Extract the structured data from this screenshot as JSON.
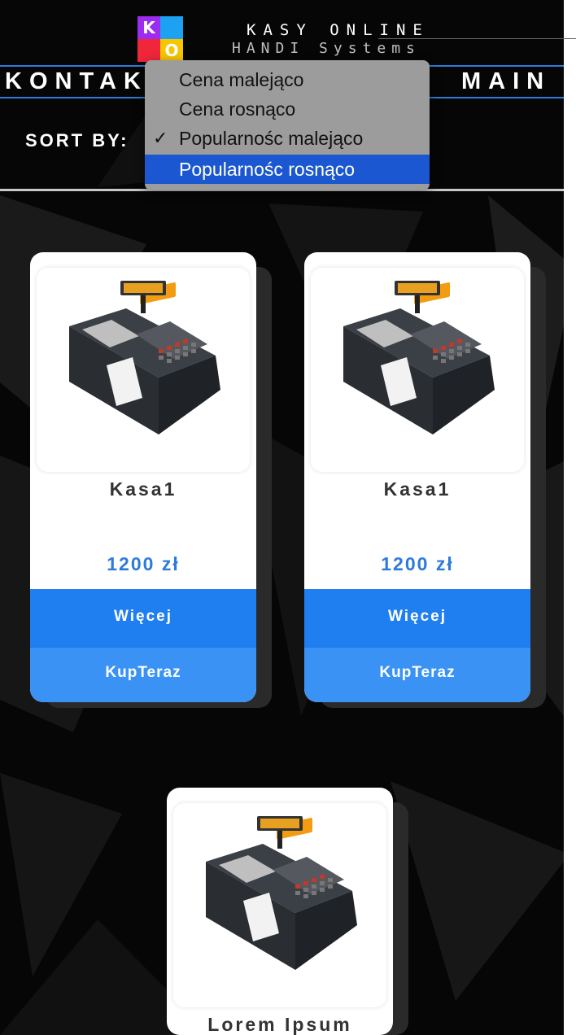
{
  "header": {
    "logo_letters": [
      "K",
      "O"
    ],
    "brand_title": "KASY ONLINE",
    "brand_subtitle": "HANDI Systems",
    "nav_left": "KONTAK",
    "nav_right": "MAIN"
  },
  "sort": {
    "label": "SORT BY:",
    "checked_option": "Popularnośc malejąco",
    "highlighted_option": "Popularnośc rosnąco",
    "options": [
      {
        "label": "Cena malejąco"
      },
      {
        "label": "Cena rosnąco"
      },
      {
        "label": "Popularnośc malejąco"
      },
      {
        "label": "Popularnośc rosnąco"
      }
    ],
    "check_glyph": "✓"
  },
  "products": [
    {
      "name": "Kasa1",
      "price": "1200 zł",
      "more_label": "Więcej",
      "buy_label": "KupTeraz",
      "image": "cash-register-image"
    },
    {
      "name": "Kasa1",
      "price": "1200 zł",
      "more_label": "Więcej",
      "buy_label": "KupTeraz",
      "image": "cash-register-image"
    },
    {
      "name": "Lorem Ipsum",
      "image": "cash-register-image"
    }
  ],
  "colors": {
    "accent_blue": "#2e7bd9",
    "button_more": "#1f7ff0",
    "button_buy": "#3a93f4",
    "dropdown_highlight": "#1a57d0"
  }
}
